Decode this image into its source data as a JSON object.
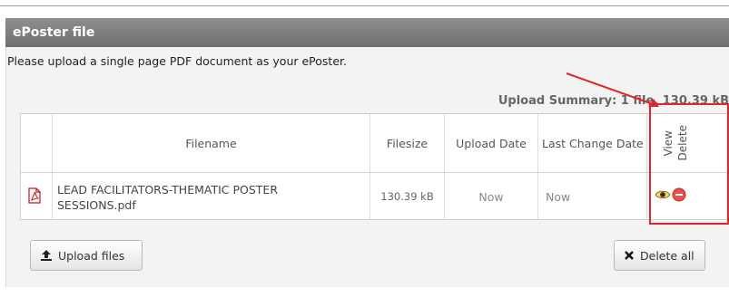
{
  "panel": {
    "title": "ePoster file",
    "instruction": "Please upload a single page PDF document as your ePoster."
  },
  "summary": {
    "text": "Upload Summary: 1 file, 130.39 kB"
  },
  "table": {
    "columns": {
      "filename": "Filename",
      "filesize": "Filesize",
      "upload_date": "Upload Date",
      "last_change_date": "Last Change Date",
      "view": "View",
      "delete": "Delete"
    },
    "rows": [
      {
        "filename_line1": "LEAD FACILITATORS-THEMATIC POSTER",
        "filename_line2": "SESSIONS.pdf",
        "filesize": "130.39 kB",
        "upload_date": "Now",
        "last_change_date": "Now"
      }
    ]
  },
  "buttons": {
    "upload": "Upload files",
    "delete_all": "Delete all"
  },
  "icons": {
    "file": "pdf-file-icon",
    "view": "eye-icon",
    "delete": "minus-circle-icon",
    "upload": "upload-icon",
    "delete_all": "x-icon"
  },
  "colors": {
    "header_bg": "#7f7f7f",
    "annotation": "#e0252b"
  }
}
